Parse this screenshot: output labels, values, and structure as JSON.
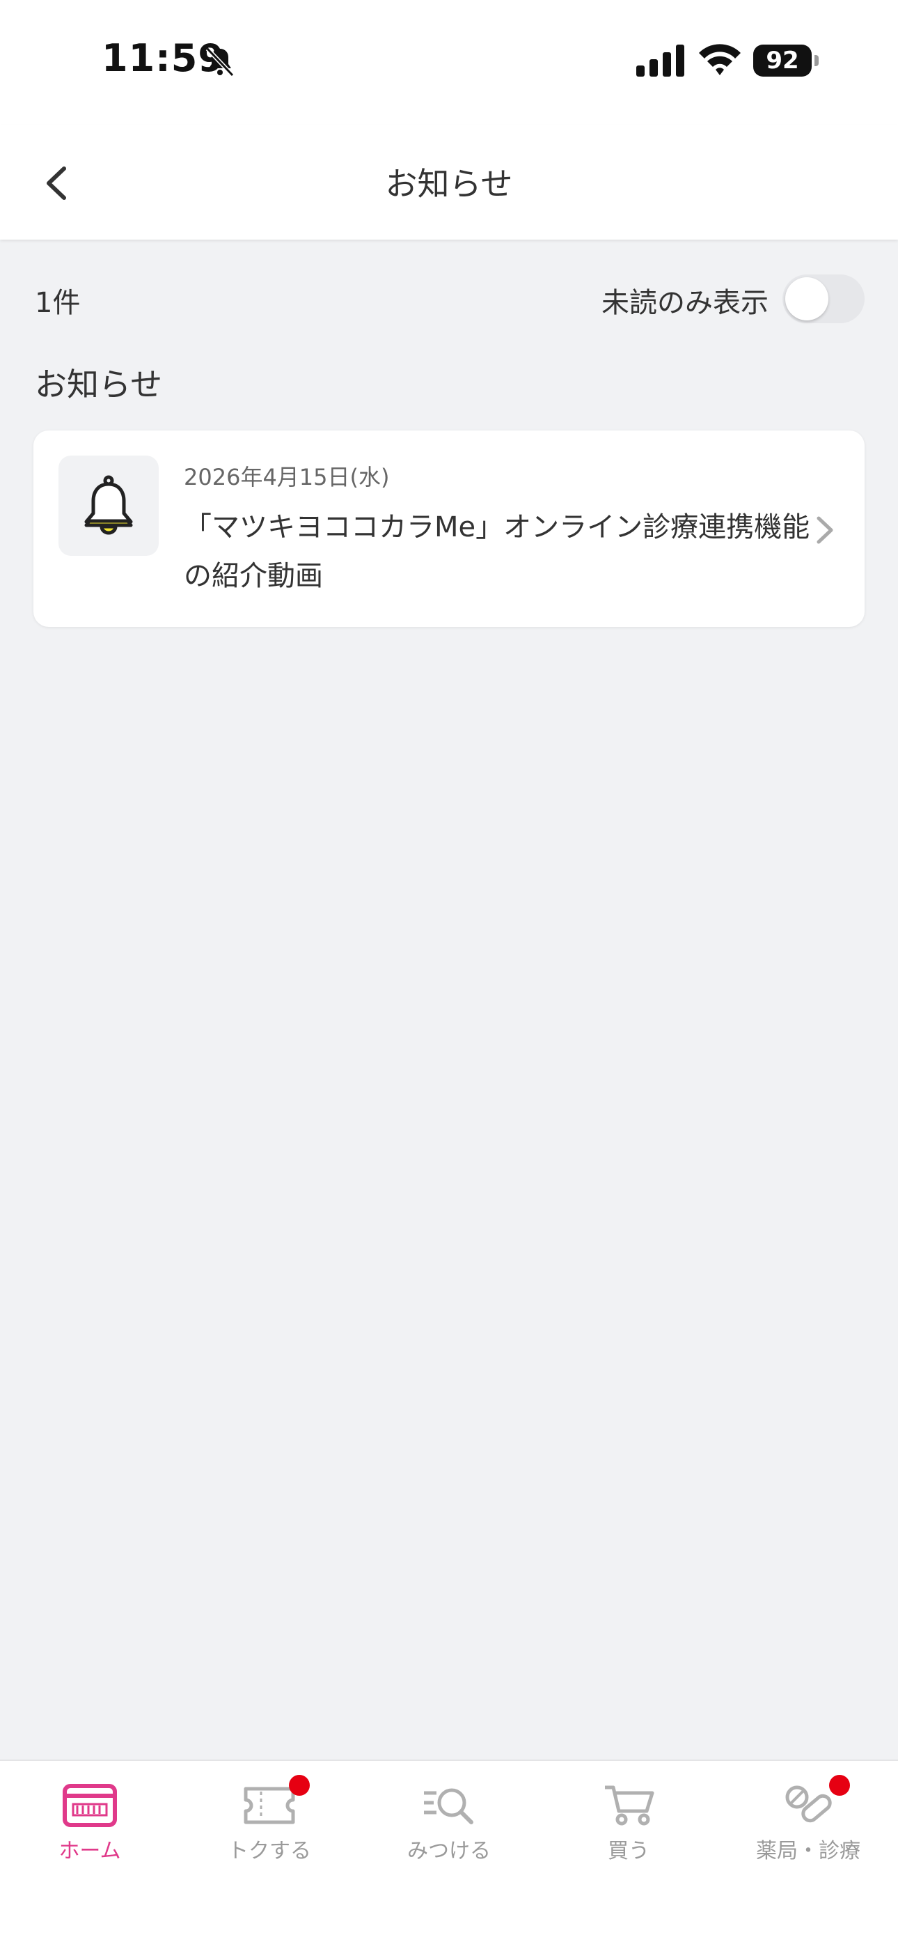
{
  "status_bar": {
    "time": "11:59",
    "battery": "92"
  },
  "header": {
    "title": "お知らせ"
  },
  "filter": {
    "count": "1件",
    "unread_only_label": "未読のみ表示",
    "unread_only": false
  },
  "section": {
    "title": "お知らせ"
  },
  "notices": [
    {
      "date": "2026年4月15日(水)",
      "title": "「マツキヨココカラMe」オンライン診療連携機能の紹介動画"
    }
  ],
  "tabs": [
    {
      "label": "ホーム",
      "icon": "home-card-icon",
      "active": true,
      "badge": false
    },
    {
      "label": "トクする",
      "icon": "ticket-icon",
      "active": false,
      "badge": true
    },
    {
      "label": "みつける",
      "icon": "search-list-icon",
      "active": false,
      "badge": false
    },
    {
      "label": "買う",
      "icon": "cart-icon",
      "active": false,
      "badge": false
    },
    {
      "label": "薬局・診療",
      "icon": "pill-icon",
      "active": false,
      "badge": true
    }
  ],
  "colors": {
    "accent": "#e0398a",
    "badge": "#e60012",
    "background": "#f1f2f4"
  }
}
